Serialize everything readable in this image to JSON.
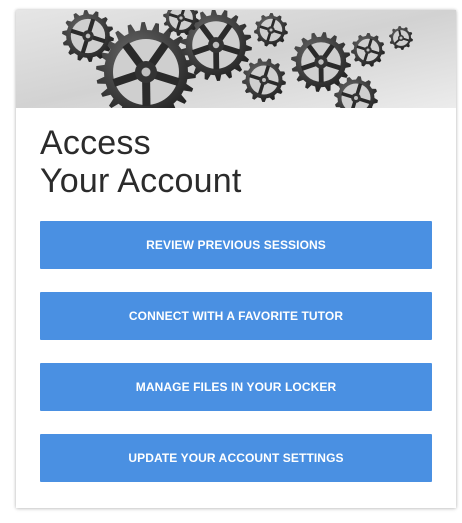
{
  "card": {
    "hero_image": "gears-image",
    "title_line1": "Access",
    "title_line2": "Your Account"
  },
  "actions": [
    {
      "label": "REVIEW PREVIOUS SESSIONS"
    },
    {
      "label": "CONNECT WITH A FAVORITE TUTOR"
    },
    {
      "label": "MANAGE FILES IN YOUR LOCKER"
    },
    {
      "label": "UPDATE YOUR ACCOUNT SETTINGS"
    }
  ],
  "colors": {
    "button_bg": "#4a90e2",
    "button_text": "#ffffff",
    "title_text": "#2b2b2b",
    "hero_bg": "#d9d9d9"
  }
}
